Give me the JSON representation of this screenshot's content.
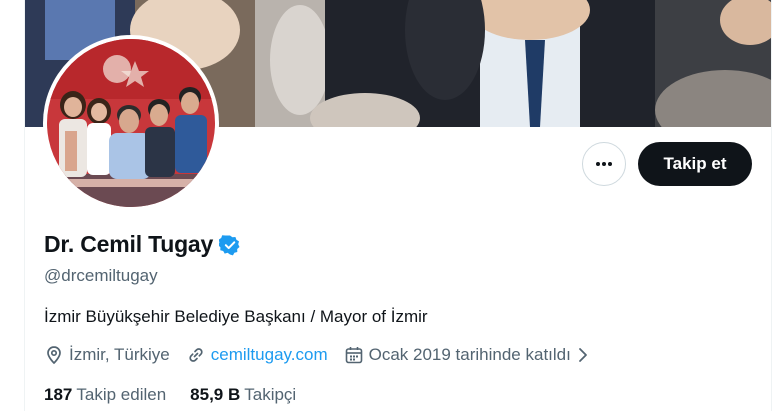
{
  "profile": {
    "display_name": "Dr. Cemil Tugay",
    "handle": "@drcemiltugay",
    "bio": "İzmir Büyükşehir Belediye Başkanı / Mayor of İzmir",
    "location": "İzmir, Türkiye",
    "website": "cemiltugay.com",
    "joined": "Ocak 2019 tarihinde katıldı"
  },
  "actions": {
    "follow_label": "Takip et"
  },
  "stats": {
    "following_count": "187",
    "following_label": "Takip edilen",
    "followers_count": "85,9 B",
    "followers_label": "Takipçi"
  },
  "icons": {
    "more": "more-icon",
    "verified": "verified-badge-icon",
    "location": "location-pin-icon",
    "link": "link-icon",
    "calendar": "calendar-icon",
    "chevron": "chevron-right-icon"
  },
  "colors": {
    "primary_text": "#0f1419",
    "secondary_text": "#536471",
    "link": "#1d9bf0",
    "verified": "#1d9bf0",
    "follow_bg": "#0f1419",
    "border": "#cfd9de"
  }
}
